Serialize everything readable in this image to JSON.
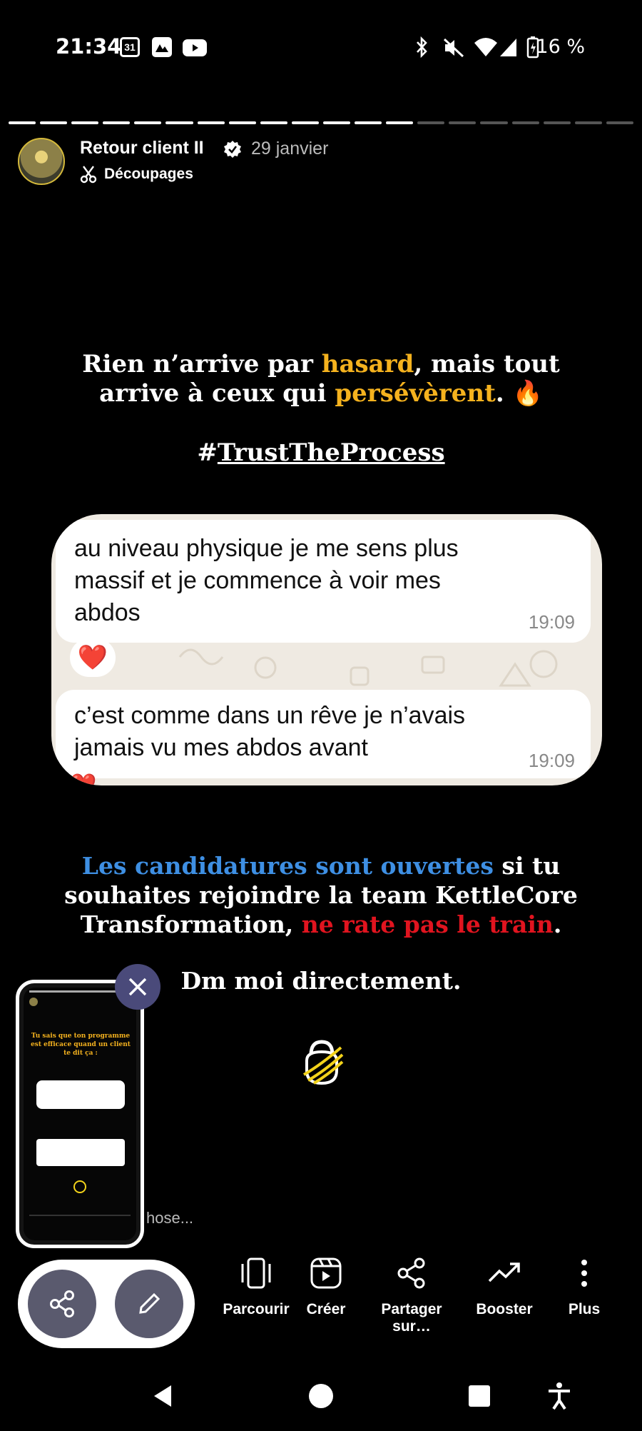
{
  "status_bar": {
    "time": "21:34",
    "calendar_day": "31",
    "battery_percent": "16 %",
    "icons_left": [
      "calendar-icon",
      "photos-icon",
      "youtube-icon"
    ],
    "icons_right": [
      "bluetooth-icon",
      "mute-icon",
      "wifi-icon",
      "signal-icon",
      "battery-icon"
    ]
  },
  "story": {
    "progress_total": 20,
    "progress_viewed": 13,
    "author": "Retour client II",
    "date": "29 janvier",
    "sublabel": "Découpages",
    "headline_a": "Rien n’arrive par ",
    "headline_b": "hasard",
    "headline_c": ", mais tout arrive à ceux qui ",
    "headline_d": "persévèrent",
    "headline_e": ". 🔥",
    "hashtag_prefix": "#",
    "hashtag": "TrustTheProcess",
    "messages": [
      {
        "text": "au niveau physique je me sens plus massif et je commence à voir mes abdos",
        "time": "19:09",
        "reaction": "❤️"
      },
      {
        "text": "c’est comme dans un rêve je n’avais jamais vu mes abdos avant",
        "time": "19:09",
        "reaction": "❤️"
      }
    ],
    "cta_a": "Les candidatures sont ouvertes",
    "cta_b": " si tu souhaites rejoindre la team KettleCore Transformation, ",
    "cta_c": "ne rate pas le train",
    "cta_d": ".",
    "dm": "Dm moi directement.",
    "comment_hint": "hose..."
  },
  "preview": {
    "title": "Tu sais que ton programme est efficace quand un client te dit ça :"
  },
  "actions": [
    {
      "label": "Parcourir",
      "icon": "carousel-icon"
    },
    {
      "label": "Créer",
      "icon": "reels-create-icon"
    },
    {
      "label": "Partager sur…",
      "icon": "share-icon"
    },
    {
      "label": "Booster",
      "icon": "trend-up-icon"
    },
    {
      "label": "Plus",
      "icon": "more-vertical-icon"
    }
  ],
  "colors": {
    "accent_yellow": "#f5b21e",
    "accent_blue": "#3e8fe3",
    "accent_red": "#e1141f",
    "fab_gray": "#5a5a6e"
  }
}
